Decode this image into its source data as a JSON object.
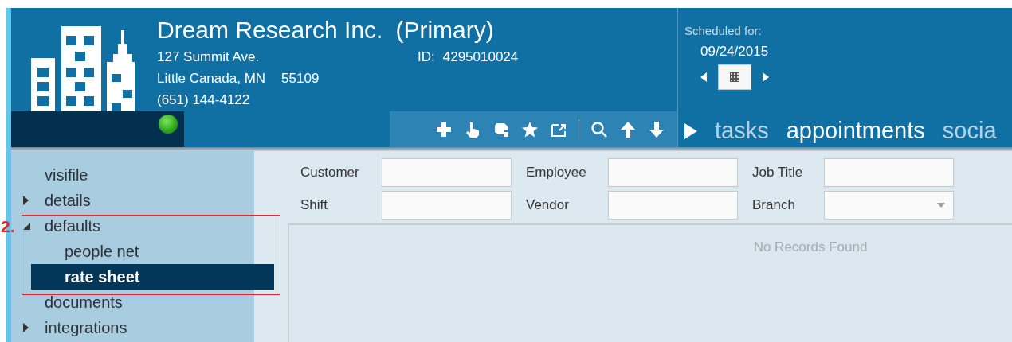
{
  "company": {
    "name": "Dream Research Inc.",
    "designation": "(Primary)",
    "address_lines": [
      "127 Summit Ave.",
      "Little Canada, MN",
      "(651) 144-4122"
    ],
    "zip": "55109",
    "id_label": "ID:",
    "id_value": "4295010024"
  },
  "schedule": {
    "label": "Scheduled for:",
    "date": "09/24/2015"
  },
  "tabs": [
    {
      "label": "tasks",
      "selected": false
    },
    {
      "label": "appointments",
      "selected": true
    },
    {
      "label": "socia",
      "selected": false
    }
  ],
  "sidebar": {
    "items": [
      {
        "label": "visifile",
        "selected": false
      },
      {
        "label": "details",
        "kind": "group",
        "expanded": false,
        "selected": false
      },
      {
        "label": "defaults",
        "kind": "group",
        "expanded": true,
        "selected": false,
        "children": [
          {
            "label": "people net",
            "selected": false
          },
          {
            "label": "rate sheet",
            "selected": true
          }
        ]
      },
      {
        "label": "documents",
        "selected": false
      },
      {
        "label": "integrations",
        "kind": "group",
        "expanded": false,
        "selected": false
      }
    ]
  },
  "annotation": {
    "label": "2."
  },
  "filters": [
    {
      "label": "Customer",
      "kind": "text"
    },
    {
      "label": "Employee",
      "kind": "text"
    },
    {
      "label": "Job Title",
      "kind": "text"
    },
    {
      "label": "Shift",
      "kind": "text"
    },
    {
      "label": "Vendor",
      "kind": "text"
    },
    {
      "label": "Branch",
      "kind": "select"
    }
  ],
  "grid": {
    "empty_message": "No Records Found"
  }
}
